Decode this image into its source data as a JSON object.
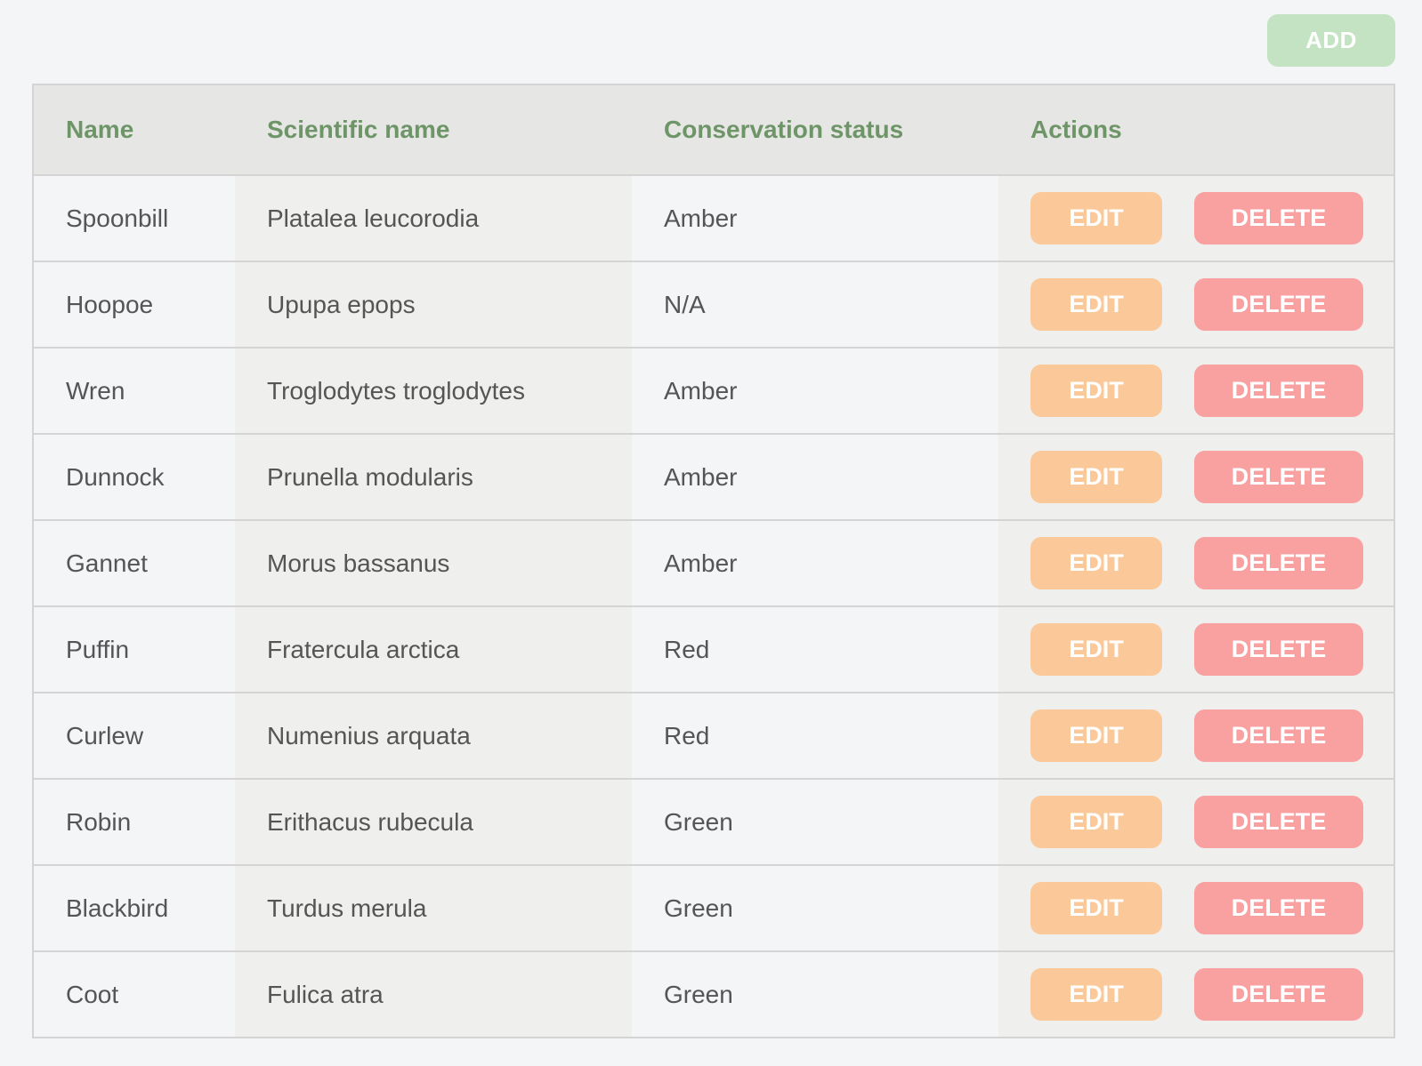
{
  "toolbar": {
    "add_label": "ADD"
  },
  "table": {
    "headers": [
      "Name",
      "Scientific name",
      "Conservation status",
      "Actions"
    ],
    "edit_label": "EDIT",
    "delete_label": "DELETE",
    "rows": [
      {
        "name": "Spoonbill",
        "scientific": "Platalea leucorodia",
        "status": "Amber"
      },
      {
        "name": "Hoopoe",
        "scientific": "Upupa epops",
        "status": "N/A"
      },
      {
        "name": "Wren",
        "scientific": "Troglodytes troglodytes",
        "status": "Amber"
      },
      {
        "name": "Dunnock",
        "scientific": "Prunella modularis",
        "status": "Amber"
      },
      {
        "name": "Gannet",
        "scientific": "Morus bassanus",
        "status": "Amber"
      },
      {
        "name": "Puffin",
        "scientific": "Fratercula arctica",
        "status": "Red"
      },
      {
        "name": "Curlew",
        "scientific": "Numenius arquata",
        "status": "Red"
      },
      {
        "name": "Robin",
        "scientific": "Erithacus rubecula",
        "status": "Green"
      },
      {
        "name": "Blackbird",
        "scientific": "Turdus merula",
        "status": "Green"
      },
      {
        "name": "Coot",
        "scientific": "Fulica atra",
        "status": "Green"
      }
    ]
  },
  "colors": {
    "add": "#c3e3c3",
    "edit": "#fbc999",
    "delete": "#f9a0a1",
    "header_text": "#6e9568"
  }
}
